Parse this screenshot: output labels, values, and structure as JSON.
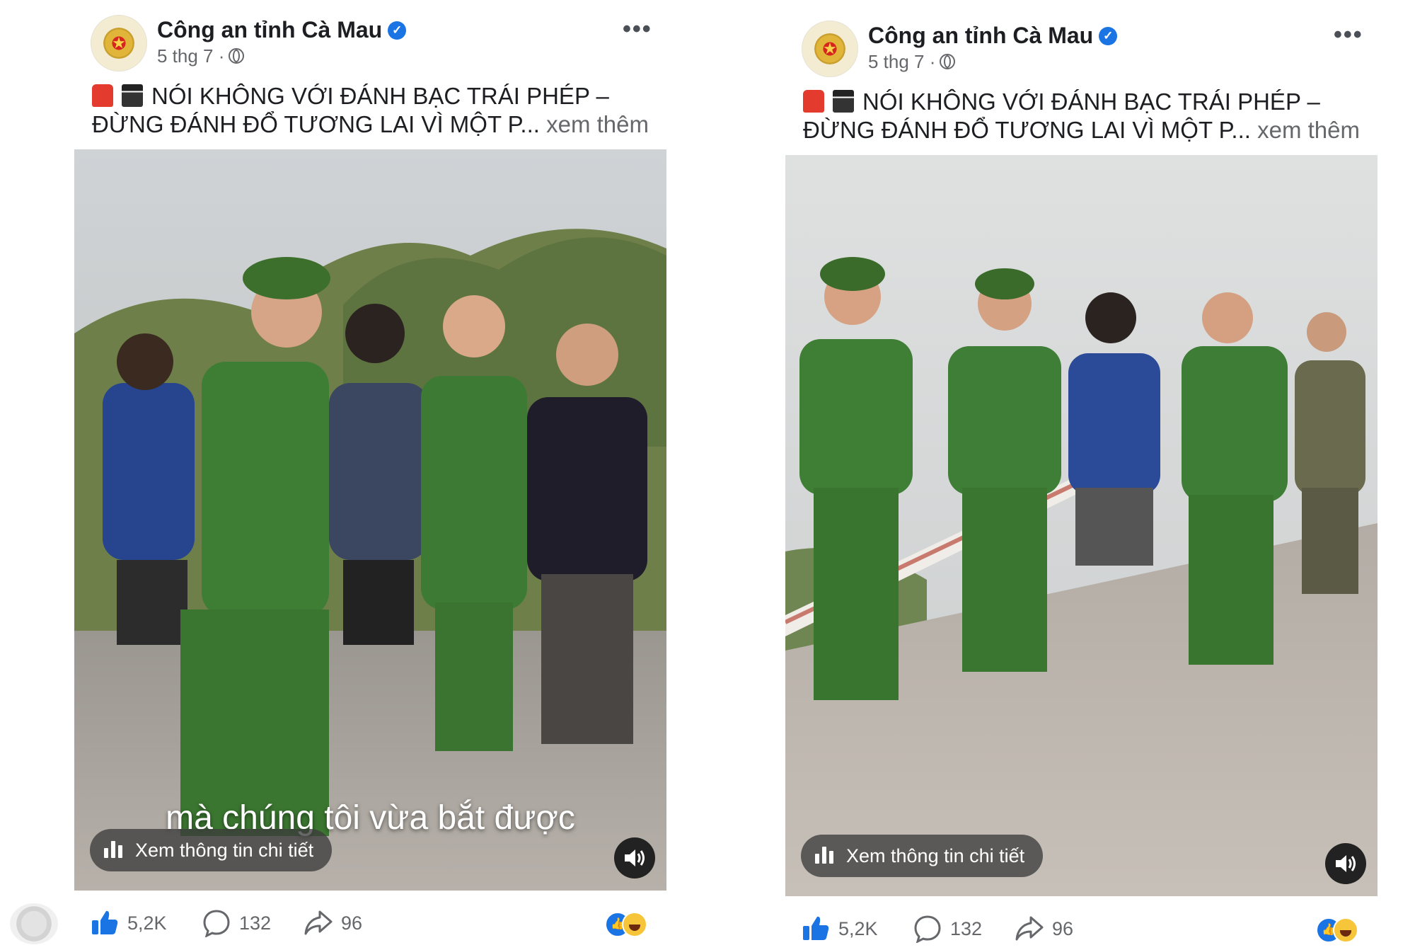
{
  "posts": [
    {
      "page_name": "Công an tỉnh Cà Mau",
      "date": "5 thg 7",
      "separator": "·",
      "caption_line1": "NÓI KHÔNG VỚI ĐÁNH BẠC TRÁI PHÉP –",
      "caption_line2": "ĐỪNG ĐÁNH ĐỔ TƯƠNG LAI VÌ MỘT P...",
      "see_more": "xem thêm",
      "subtitle": "mà chúng tôi vừa bắt được",
      "info_pill": "Xem thông tin chi tiết",
      "likes": "5,2K",
      "comments": "132",
      "shares": "96"
    },
    {
      "page_name": "Công an tỉnh Cà Mau",
      "date": "5 thg 7",
      "separator": "·",
      "caption_line1": "NÓI KHÔNG VỚI ĐÁNH BẠC TRÁI PHÉP –",
      "caption_line2": "ĐỪNG ĐÁNH ĐỔ TƯƠNG LAI VÌ MỘT P...",
      "see_more": "xem thêm",
      "info_pill": "Xem thông tin chi tiết",
      "likes": "5,2K",
      "comments": "132",
      "shares": "96"
    }
  ],
  "icons": {
    "verified": "verified-badge-icon",
    "audience": "globe-icon",
    "more": "more-options-icon",
    "caption_emoji_1": "siren-emoji",
    "caption_emoji_2": "clapper-board-emoji",
    "info": "bar-chart-icon",
    "sound": "speaker-icon",
    "like": "thumbs-up-icon",
    "comment": "comment-icon",
    "share": "share-icon"
  },
  "colors": {
    "accent": "#1b74e4",
    "text": "#1c1e21",
    "muted": "#65676b",
    "uniform": "#3f7a32"
  }
}
